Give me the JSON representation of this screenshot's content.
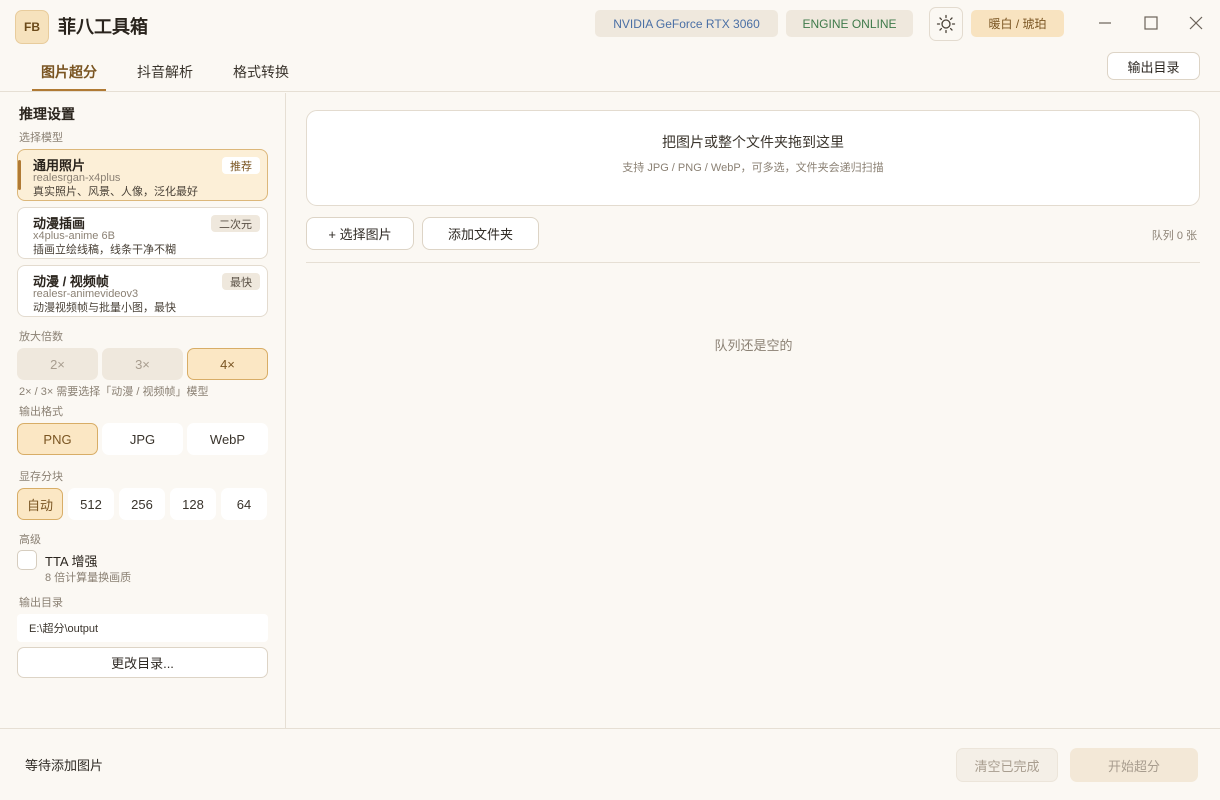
{
  "app": {
    "logo_text": "FB",
    "title": "菲八工具箱"
  },
  "header": {
    "gpu": "NVIDIA GeForce RTX 3060",
    "engine": "ENGINE ONLINE",
    "theme_label": "暖白 / 琥珀"
  },
  "tabs": [
    {
      "label": "图片超分",
      "active": true
    },
    {
      "label": "抖音解析",
      "active": false
    },
    {
      "label": "格式转换",
      "active": false
    }
  ],
  "toolbar": {
    "output_dir_button": "输出目录"
  },
  "sidebar": {
    "title": "推理设置",
    "model_label": "选择模型",
    "models": [
      {
        "name": "通用照片",
        "id": "realesrgan-x4plus",
        "desc": "真实照片、风景、人像，泛化最好",
        "badge": "推荐",
        "selected": true
      },
      {
        "name": "动漫插画",
        "id": "x4plus-anime 6B",
        "desc": "插画立绘线稿，线条干净不糊",
        "badge": "二次元",
        "selected": false
      },
      {
        "name": "动漫 / 视频帧",
        "id": "realesr-animevideov3",
        "desc": "动漫视频帧与批量小图，最快",
        "badge": "最快",
        "selected": false
      }
    ],
    "scale_label": "放大倍数",
    "scales": [
      "2×",
      "3×",
      "4×"
    ],
    "scale_selected": "4×",
    "scale_hint": "2× / 3× 需要选择「动漫 / 视频帧」模型",
    "format_label": "输出格式",
    "formats": [
      "PNG",
      "JPG",
      "WebP"
    ],
    "format_selected": "PNG",
    "tile_label": "显存分块",
    "tiles": [
      "自动",
      "512",
      "256",
      "128",
      "64"
    ],
    "tile_selected": "自动",
    "advanced_label": "高级",
    "tta_label": "TTA 增强",
    "tta_desc": "8 倍计算量换画质",
    "tta_checked": false,
    "output_label": "输出目录",
    "output_path": "E:\\超分\\output",
    "change_dir_button": "更改目录..."
  },
  "main": {
    "drop_title": "把图片或整个文件夹拖到这里",
    "drop_subtitle": "支持 JPG / PNG / WebP，可多选，文件夹会递归扫描",
    "select_images_button": "+ 选择图片",
    "add_folder_button": "添加文件夹",
    "queue_count": "队列 0 张",
    "empty_message": "队列还是空的"
  },
  "footer": {
    "status": "等待添加图片",
    "clear_button": "清空已完成",
    "start_button": "开始超分"
  },
  "colors": {
    "accent": "#b07a34",
    "background": "#fbf8f3",
    "selected_bg": "#fcefd7",
    "gpu_text": "#4a6fa5",
    "engine_text": "#3f7a4a"
  }
}
